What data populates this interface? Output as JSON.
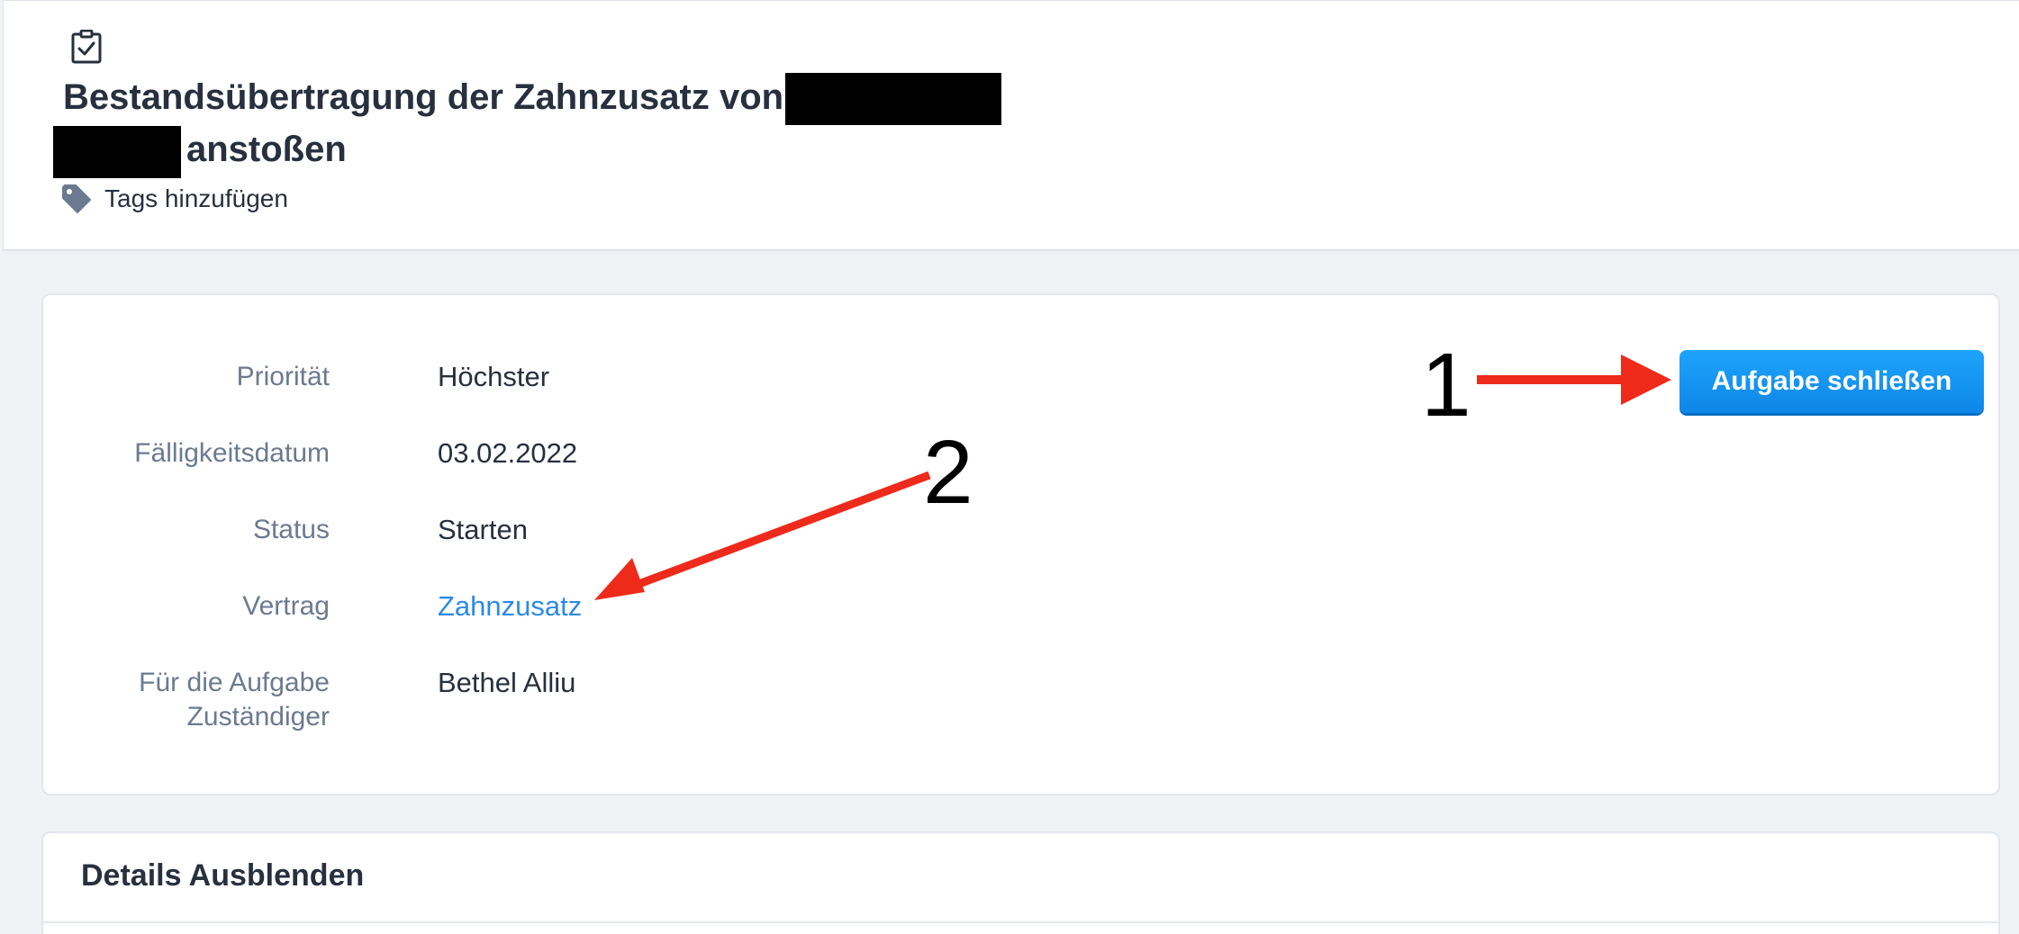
{
  "task": {
    "title_part1": "Bestandsübertragung der Zahnzusatz von",
    "title_part2": "anstoßen",
    "tags_label": "Tags hinzufügen"
  },
  "icons": {
    "task": "clipboard-check-icon",
    "tag": "tag-icon"
  },
  "fields": [
    {
      "label": "Priorität",
      "value": "Höchster"
    },
    {
      "label": "Fälligkeitsdatum",
      "value": "03.02.2022"
    },
    {
      "label": "Status",
      "value": "Starten"
    },
    {
      "label": "Vertrag",
      "value": "Zahnzusatz"
    },
    {
      "label": "Für die Aufgabe Zuständiger",
      "value": "Bethel Alliu"
    }
  ],
  "actions": {
    "close_task": "Aufgabe schließen"
  },
  "annotations": {
    "marker_1": "1",
    "marker_2": "2"
  },
  "details": {
    "toggle_label": "Details Ausblenden"
  },
  "colors": {
    "accent": "#1a9af6",
    "link": "#2b8ae6",
    "annotation_arrow": "#ee2a1a",
    "label_gray": "#6b7a90",
    "background": "#f0f3f6"
  }
}
